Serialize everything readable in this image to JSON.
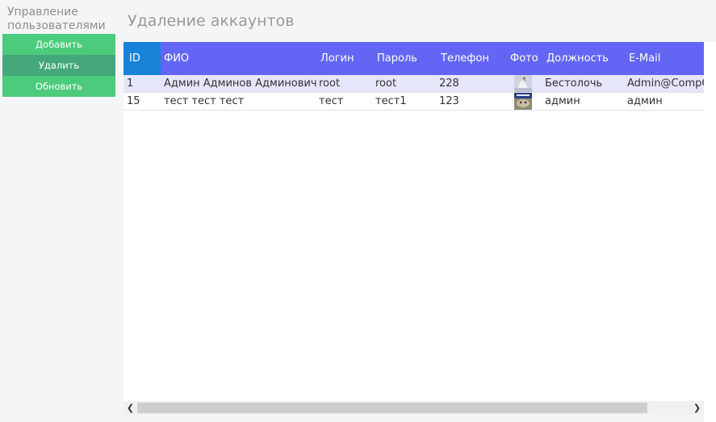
{
  "sidebar": {
    "title": "Управление пользователями",
    "buttons": {
      "add": "Добавить",
      "delete": "Удалить",
      "refresh": "Обновить"
    }
  },
  "page": {
    "title": "Удаление аккаунтов"
  },
  "table": {
    "headers": {
      "id": "ID",
      "fio": "ФИО",
      "login": "Логин",
      "password": "Пароль",
      "phone": "Телефон",
      "photo": "Фото",
      "position": "Должность",
      "email": "E-Mail"
    },
    "rows": [
      {
        "id": "1",
        "fio": "Админ Админов Админович",
        "login": "root",
        "password": "root",
        "phone": "228",
        "position": "Бестолочь",
        "email": "Admin@CompCorp"
      },
      {
        "id": "15",
        "fio": "тест тест тест",
        "login": "тест",
        "password": "тест1",
        "phone": "123",
        "position": "админ",
        "email": "админ"
      }
    ]
  },
  "colors": {
    "header": "#6366f5",
    "id_header": "#1782d8",
    "button": "#4ccb7c",
    "button_active": "#45a87b",
    "selected_row": "#e6e6fb"
  },
  "icons": {
    "scroll_left": "chevron-left-icon",
    "scroll_right": "chevron-right-icon"
  }
}
